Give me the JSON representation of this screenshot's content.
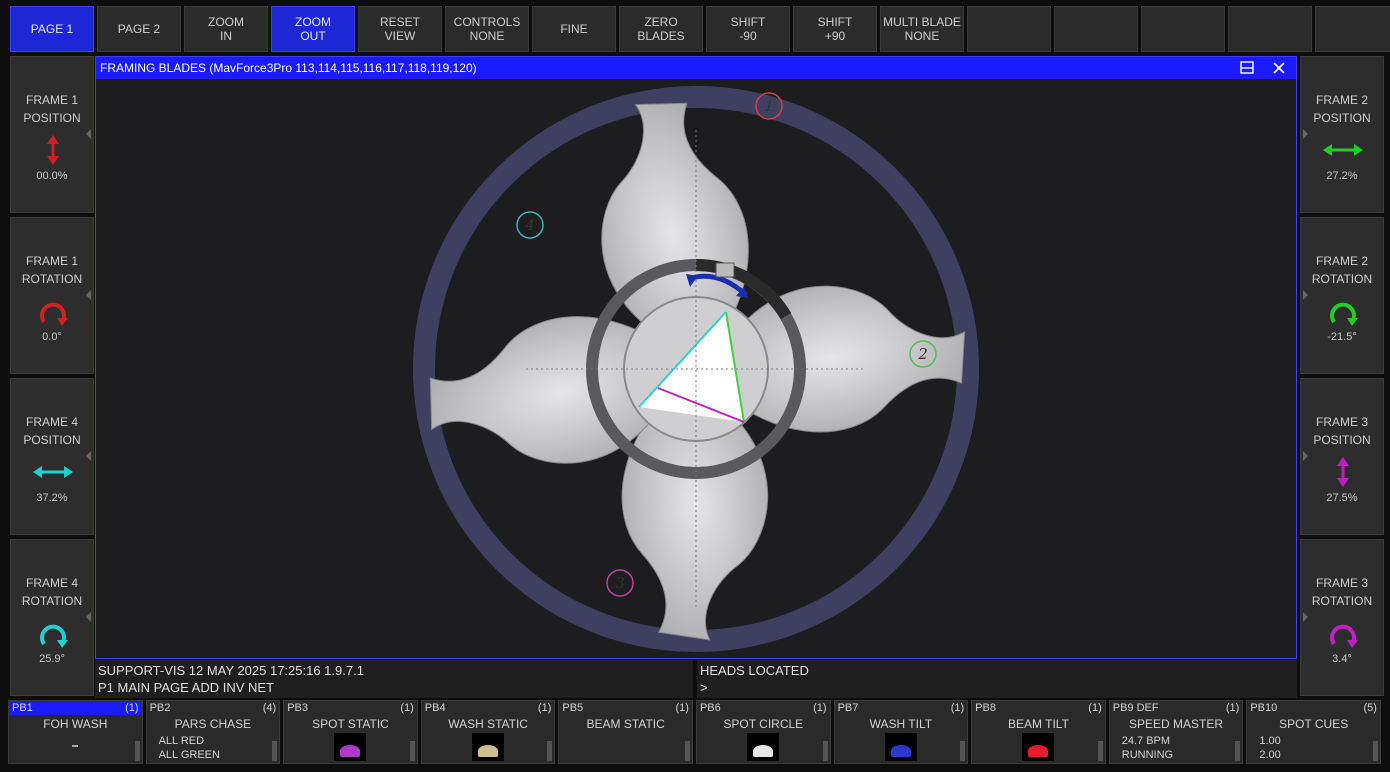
{
  "topbar": [
    {
      "label": "PAGE 1",
      "active": true
    },
    {
      "label": "PAGE 2",
      "active": false
    },
    {
      "label": "ZOOM\nIN",
      "active": false
    },
    {
      "label": "ZOOM\nOUT",
      "active": true
    },
    {
      "label": "RESET\nVIEW",
      "active": false
    },
    {
      "label": "CONTROLS\nNONE",
      "active": false
    },
    {
      "label": "FINE",
      "active": false
    },
    {
      "label": "ZERO\nBLADES",
      "active": false
    },
    {
      "label": "SHIFT\n-90",
      "active": false
    },
    {
      "label": "SHIFT\n+90",
      "active": false
    },
    {
      "label": "MULTI BLADE\nNONE",
      "active": false
    },
    {
      "label": "",
      "active": false
    },
    {
      "label": "",
      "active": false
    },
    {
      "label": "",
      "active": false
    },
    {
      "label": "",
      "active": false
    },
    {
      "label": "",
      "active": false
    }
  ],
  "left": [
    {
      "label": "FRAME 1\nPOSITION",
      "value": "00.0%",
      "icon": "vertical-double-arrow-icon",
      "color": "#d02020"
    },
    {
      "label": "FRAME 1\nROTATION",
      "value": "0.0°",
      "icon": "rotate-arc-icon",
      "color": "#d02020"
    },
    {
      "label": "FRAME 4\nPOSITION",
      "value": "37.2%",
      "icon": "horizontal-double-arrow-icon",
      "color": "#20d0d0"
    },
    {
      "label": "FRAME 4\nROTATION",
      "value": "25.9°",
      "icon": "rotate-clockwise-icon",
      "color": "#20d0d0"
    }
  ],
  "right": [
    {
      "label": "FRAME 2\nPOSITION",
      "value": "27.2%",
      "icon": "horizontal-double-arrow-icon",
      "color": "#20d020"
    },
    {
      "label": "FRAME 2\nROTATION",
      "value": "-21.5°",
      "icon": "rotate-counterclockwise-icon",
      "color": "#20d020"
    },
    {
      "label": "FRAME 3\nPOSITION",
      "value": "27.5%",
      "icon": "vertical-double-arrow-icon",
      "color": "#c020c0"
    },
    {
      "label": "FRAME 3\nROTATION",
      "value": "3.4°",
      "icon": "rotate-arc-down-icon",
      "color": "#c020c0"
    }
  ],
  "window": {
    "title": "FRAMING BLADES (MavForce3Pro 113,114,115,116,117,118,119,120)"
  },
  "blades": [
    {
      "num": "1",
      "color": "#d04040"
    },
    {
      "num": "2",
      "color": "#50c050"
    },
    {
      "num": "3",
      "color": "#c040a0"
    },
    {
      "num": "4",
      "color": "#40b0c0"
    }
  ],
  "status": {
    "line1": "SUPPORT-VIS 12 MAY 2025 17:25:16 1.9.7.1",
    "line2": "P1 MAIN PAGE   ADD INV NET",
    "right1": "HEADS LOCATED",
    "right2": ">"
  },
  "playbacks": [
    {
      "id": "PB1",
      "count": "(1)",
      "name": "FOH WASH",
      "sub": "",
      "thumb": "tiny-mark",
      "selected": true
    },
    {
      "id": "PB2",
      "count": "(4)",
      "name": "PARS CHASE",
      "sub": "ALL RED\nALL GREEN",
      "thumb": "",
      "selected": false
    },
    {
      "id": "PB3",
      "count": "(1)",
      "name": "SPOT STATIC",
      "sub": "",
      "thumb": "magenta-beams",
      "selected": false
    },
    {
      "id": "PB4",
      "count": "(1)",
      "name": "WASH STATIC",
      "sub": "",
      "thumb": "warm-beams",
      "selected": false
    },
    {
      "id": "PB5",
      "count": "(1)",
      "name": "BEAM STATIC",
      "sub": "",
      "thumb": "",
      "selected": false
    },
    {
      "id": "PB6",
      "count": "(1)",
      "name": "SPOT CIRCLE",
      "sub": "",
      "thumb": "white-spot",
      "selected": false
    },
    {
      "id": "PB7",
      "count": "(1)",
      "name": "WASH TILT",
      "sub": "",
      "thumb": "blue-wash",
      "selected": false
    },
    {
      "id": "PB8",
      "count": "(1)",
      "name": "BEAM TILT",
      "sub": "",
      "thumb": "red-beam",
      "selected": false
    },
    {
      "id": "PB9 DEF",
      "count": "(1)",
      "name": "SPEED MASTER",
      "sub": "24.7 BPM\nRUNNING",
      "thumb": "",
      "selected": false
    },
    {
      "id": "PB10",
      "count": "(5)",
      "name": "SPOT CUES",
      "sub": "1.00\n2.00",
      "thumb": "",
      "selected": false
    }
  ],
  "colors": {
    "accent": "#1b1bff",
    "panel": "#2b2b2b",
    "ring": "#3c3c5c",
    "blade": "#c8c8cc"
  }
}
